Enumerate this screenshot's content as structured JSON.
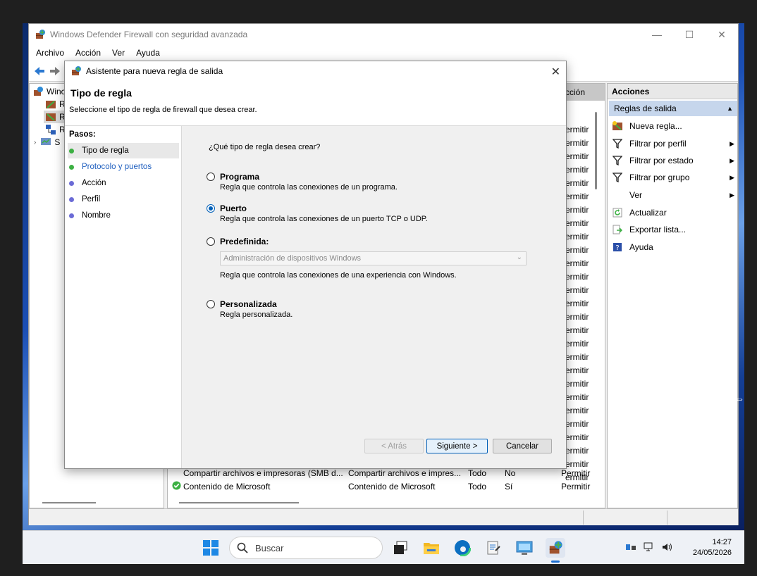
{
  "main_window": {
    "title": "Windows Defender Firewall con seguridad avanzada",
    "menu": [
      "Archivo",
      "Acción",
      "Ver",
      "Ayuda"
    ],
    "tree": [
      "Winc",
      "R",
      "R",
      "R",
      "S"
    ],
    "list": {
      "header_action": "cción",
      "permit_value": "ermitir",
      "rows": [
        {
          "name": "Compartir archivos e impresoras (SMB d...",
          "group": "Compartir archivos e impres...",
          "profile": "Todo",
          "enabled": "No",
          "action": "Permitir"
        },
        {
          "name": "Contenido de Microsoft",
          "group": "Contenido de Microsoft",
          "profile": "Todo",
          "enabled": "Sí",
          "action": "Permitir"
        }
      ]
    },
    "actions": {
      "title": "Acciones",
      "section": "Reglas de salida",
      "items": [
        {
          "label": "Nueva regla...",
          "icon": "new-rule-icon"
        },
        {
          "label": "Filtrar por perfil",
          "icon": "filter-icon",
          "submenu": true
        },
        {
          "label": "Filtrar por estado",
          "icon": "filter-icon",
          "submenu": true
        },
        {
          "label": "Filtrar por grupo",
          "icon": "filter-icon",
          "submenu": true
        },
        {
          "label": "Ver",
          "icon": "",
          "submenu": true
        },
        {
          "label": "Actualizar",
          "icon": "refresh-icon"
        },
        {
          "label": "Exportar lista...",
          "icon": "export-icon"
        },
        {
          "label": "Ayuda",
          "icon": "help-icon"
        }
      ]
    }
  },
  "wizard": {
    "title": "Asistente para nueva regla de salida",
    "heading": "Tipo de regla",
    "subtitle": "Seleccione el tipo de regla de firewall que desea crear.",
    "steps_title": "Pasos:",
    "steps": [
      "Tipo de regla",
      "Protocolo y puertos",
      "Acción",
      "Perfil",
      "Nombre"
    ],
    "question": "¿Qué tipo de regla desea crear?",
    "options": {
      "programa": {
        "label": "Programa",
        "desc": "Regla que controla las conexiones de un programa."
      },
      "puerto": {
        "label": "Puerto",
        "desc": "Regla que controla las conexiones de un puerto TCP o UDP.",
        "selected": true
      },
      "predefinida": {
        "label": "Predefinida:",
        "select_value": "Administración de dispositivos Windows",
        "desc": "Regla que controla las conexiones de una experiencia con Windows."
      },
      "personalizada": {
        "label": "Personalizada",
        "desc": "Regla personalizada."
      }
    },
    "buttons": {
      "back": "< Atrás",
      "next": "Siguiente >",
      "cancel": "Cancelar"
    }
  },
  "taskbar": {
    "search_placeholder": "Buscar",
    "time": "14:27",
    "date": "24/05/2026"
  },
  "colors": {
    "accent": "#005fb8",
    "step_done": "#3cb043",
    "step_pending": "#6b6bd6",
    "section_bg": "#c6d6ec"
  }
}
